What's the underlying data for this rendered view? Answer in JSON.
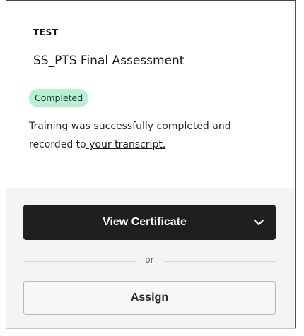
{
  "card": {
    "eyebrow": "TEST",
    "title": "SS_PTS Final Assessment",
    "status": {
      "label": "Completed",
      "color": "#b6efd4"
    },
    "description_prefix": "Training was successfully completed and recorded to",
    "transcript_link": " your transcript."
  },
  "actions": {
    "primary": {
      "label": "View Certificate",
      "icon": "chevron-down-icon"
    },
    "separator": "or",
    "secondary": {
      "label": "Assign"
    }
  },
  "colors": {
    "primary_button_bg": "#1f1f1f",
    "footer_bg": "#f4f4f4"
  }
}
